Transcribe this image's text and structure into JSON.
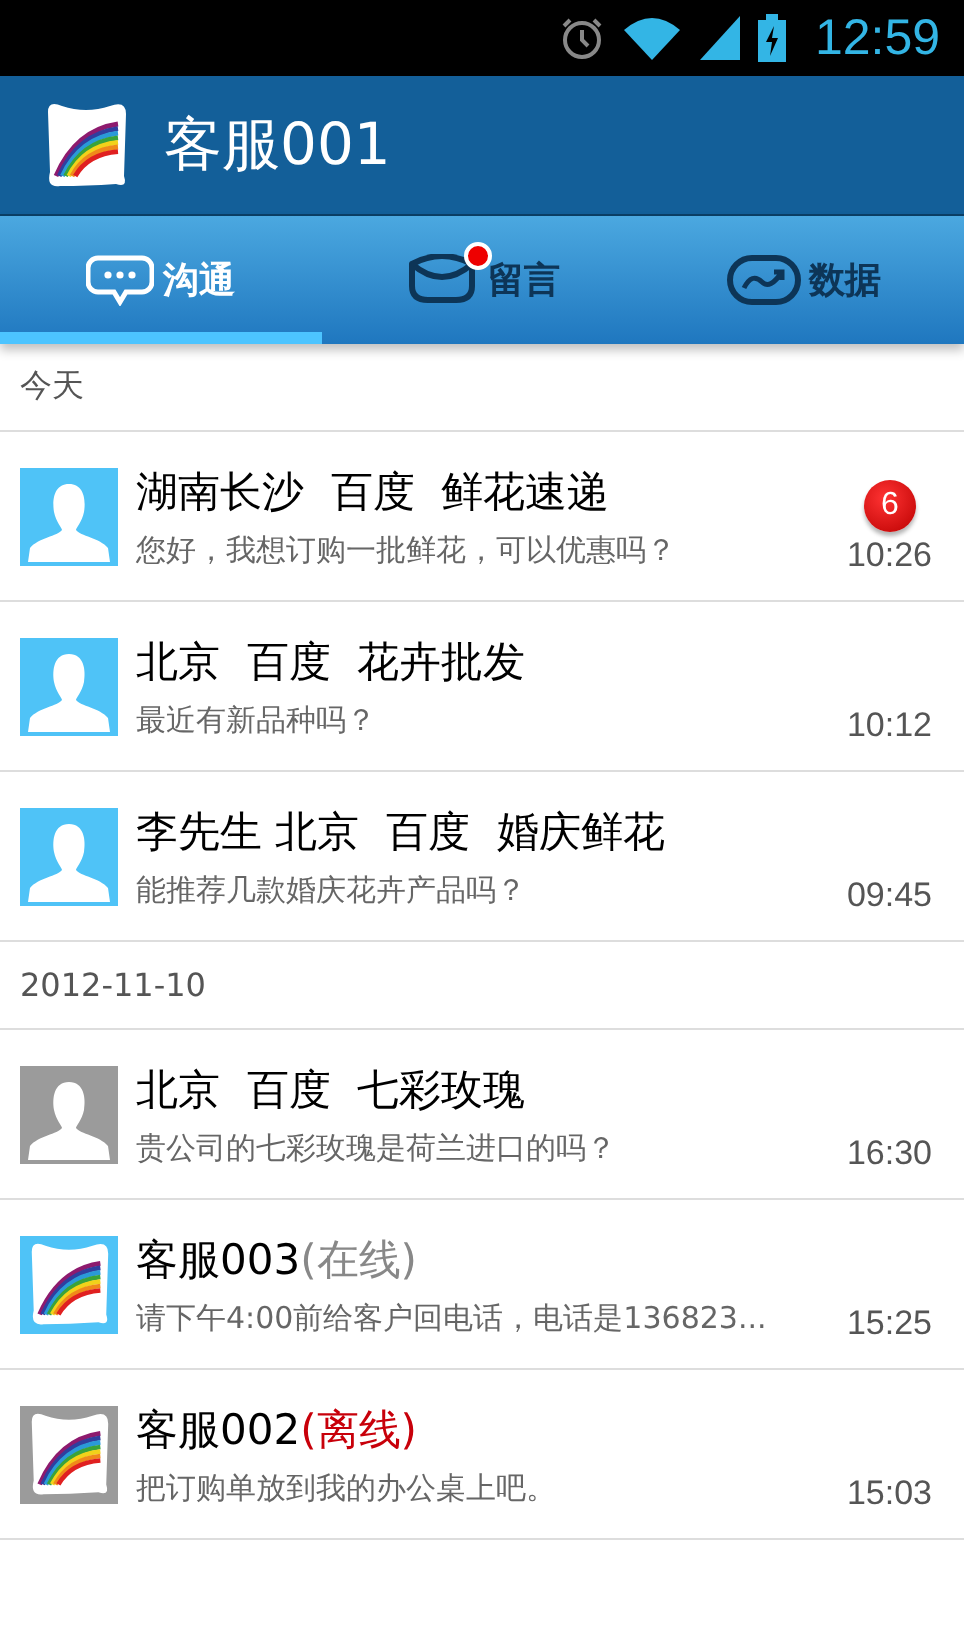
{
  "status_bar": {
    "time": "12:59"
  },
  "header": {
    "title": "客服001"
  },
  "tabs": [
    {
      "label": "沟通",
      "kind": "chat",
      "selected": true,
      "unread_dot": false
    },
    {
      "label": "留言",
      "kind": "message",
      "selected": false,
      "unread_dot": true
    },
    {
      "label": "数据",
      "kind": "chart",
      "selected": false,
      "unread_dot": false
    }
  ],
  "sections": [
    {
      "label": "今天",
      "conversations": [
        {
          "name": "湖南长沙  百度  鲜花速递",
          "kind": "person",
          "online": true,
          "message": "您好，我想订购一批鲜花，可以优惠吗？",
          "time": "10:26",
          "badge": "6"
        },
        {
          "name": "北京  百度  花卉批发",
          "kind": "person",
          "online": true,
          "message": "最近有新品种吗？",
          "time": "10:12"
        },
        {
          "name": "李先生 北京  百度  婚庆鲜花",
          "kind": "person",
          "online": true,
          "message": "能推荐几款婚庆花卉产品吗？",
          "time": "09:45"
        }
      ]
    },
    {
      "label": "2012-11-10",
      "conversations": [
        {
          "name": "北京  百度  七彩玫瑰",
          "kind": "person",
          "online": false,
          "message": "贵公司的七彩玫瑰是荷兰进口的吗？",
          "time": "16:30"
        },
        {
          "name": "客服003",
          "status": "(在线)",
          "kind": "agent",
          "online": true,
          "message": "请下午4:00前给客户回电话，电话是136823...",
          "time": "15:25"
        },
        {
          "name": "客服002",
          "status": "(离线)",
          "kind": "agent",
          "online": false,
          "message": "把订购单放到我的办公桌上吧。",
          "time": "15:03"
        }
      ]
    }
  ]
}
